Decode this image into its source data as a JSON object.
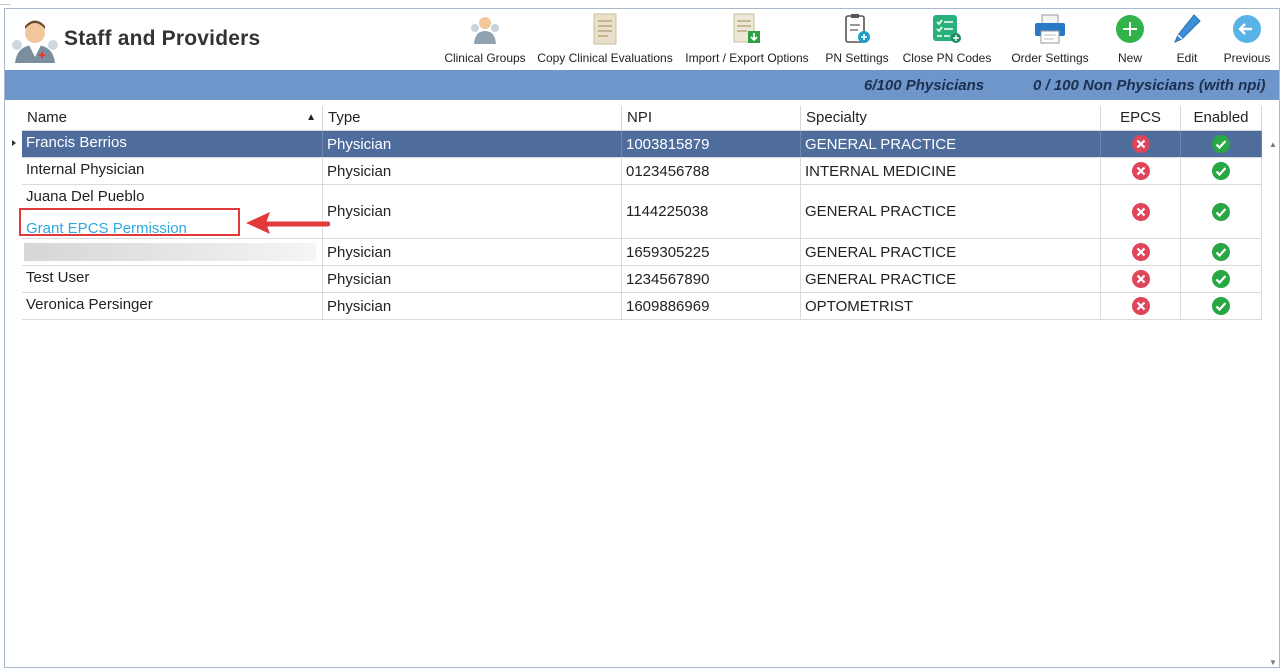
{
  "app": {
    "title": "Staff and Providers"
  },
  "toolbar": {
    "clinical_groups": "Clinical Groups",
    "copy_clinical_evaluations": "Copy Clinical Evaluations",
    "import_export_options": "Import / Export Options",
    "pn_settings": "PN Settings",
    "close_pn_codes": "Close PN Codes",
    "order_settings": "Order Settings",
    "new": "New",
    "edit": "Edit",
    "previous": "Previous"
  },
  "summary": {
    "physicians": "6/100 Physicians",
    "non_physicians": "0 / 100 Non Physicians (with npi)"
  },
  "columns": {
    "name": "Name",
    "type": "Type",
    "npi": "NPI",
    "specialty": "Specialty",
    "epcs": "EPCS",
    "enabled": "Enabled"
  },
  "rows": [
    {
      "name": "Francis Berrios",
      "type": "Physician",
      "npi": "1003815879",
      "specialty": "GENERAL PRACTICE",
      "epcs": "no",
      "enabled": "yes"
    },
    {
      "name": "Internal Physician",
      "type": "Physician",
      "npi": "0123456788",
      "specialty": "INTERNAL MEDICINE",
      "epcs": "no",
      "enabled": "yes"
    },
    {
      "name": "Juana Del Pueblo",
      "type": "Physician",
      "npi": "1144225038",
      "specialty": "GENERAL PRACTICE",
      "epcs": "no",
      "enabled": "yes",
      "link": "Grant EPCS Permission"
    },
    {
      "name": "",
      "type": "Physician",
      "npi": "1659305225",
      "specialty": "GENERAL PRACTICE",
      "epcs": "no",
      "enabled": "yes"
    },
    {
      "name": "Test User",
      "type": "Physician",
      "npi": "1234567890",
      "specialty": "GENERAL PRACTICE",
      "epcs": "no",
      "enabled": "yes"
    },
    {
      "name": "Veronica Persinger",
      "type": "Physician",
      "npi": "1609886969",
      "specialty": "OPTOMETRIST",
      "epcs": "no",
      "enabled": "yes"
    }
  ],
  "colors": {
    "summary_bar": "#6e96cb",
    "selected_row": "#4e6d9d",
    "link": "#2ea8e0",
    "annotation": "#e2393a",
    "ok_green": "#27a844",
    "no_red": "#e0465a"
  }
}
